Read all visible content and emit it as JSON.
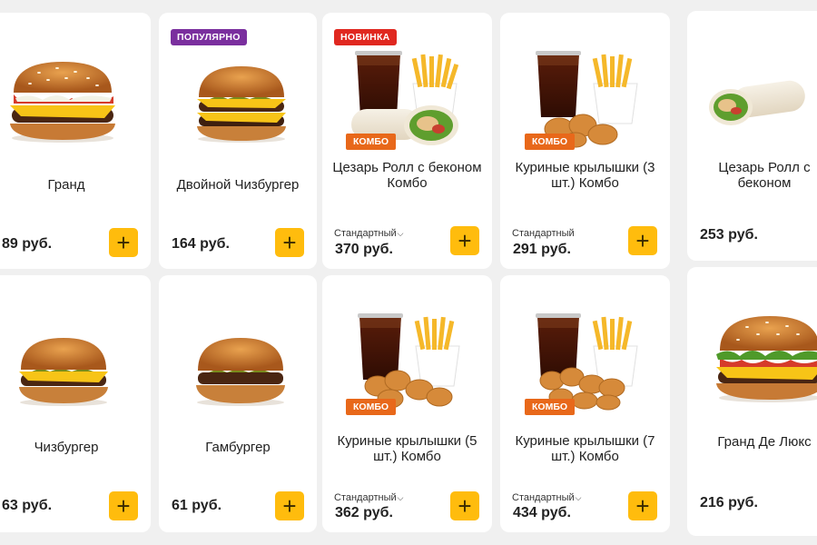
{
  "colors": {
    "accent_yellow": "#ffbc0d",
    "badge_popular": "#7a2f9e",
    "badge_new": "#e02820",
    "combo_orange": "#e8681a"
  },
  "add_icon": "plus-icon",
  "size_chevron": "chevron-down-icon",
  "products": [
    {
      "name": "Гранд",
      "price": "89 руб."
    },
    {
      "name": "Двойной Чизбургер",
      "price": "164 руб.",
      "badge": "ПОПУЛЯРНО"
    },
    {
      "name": "Цезарь Ролл с беконом Комбо",
      "price": "370 руб.",
      "badge": "НОВИНКА",
      "size": "Стандартный",
      "combo_tag": "КОМБО"
    },
    {
      "name": "Куриные крылышки (3 шт.) Комбо",
      "price": "291 руб.",
      "size": "Стандартный",
      "combo_tag": "КОМБО"
    },
    {
      "name": "Цезарь Ролл с беконом",
      "price": "253 руб."
    },
    {
      "name": "Чизбургер",
      "price": "63 руб."
    },
    {
      "name": "Гамбургер",
      "price": "61 руб."
    },
    {
      "name": "Куриные крылышки (5 шт.) Комбо",
      "price": "362 руб.",
      "size": "Стандартный",
      "combo_tag": "КОМБО"
    },
    {
      "name": "Куриные крылышки (7 шт.) Комбо",
      "price": "434 руб.",
      "size": "Стандартный",
      "combo_tag": "КОМБО"
    },
    {
      "name": "Гранд Де Люкс",
      "price": "216 руб."
    }
  ]
}
